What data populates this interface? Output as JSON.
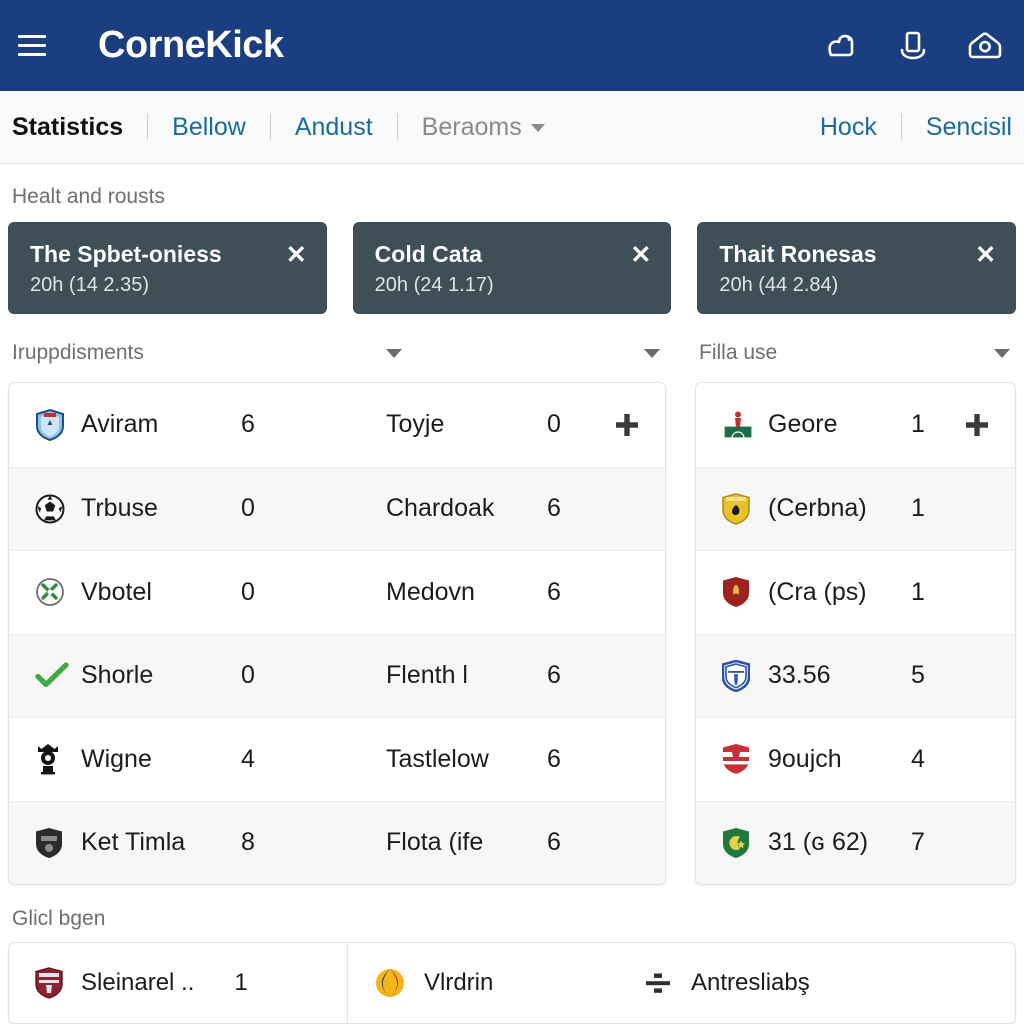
{
  "appbar": {
    "menu_icon": "hamburger-menu-icon",
    "brand": "CorneKick",
    "actions": [
      {
        "name": "thumb-outline-icon",
        "label": ""
      },
      {
        "name": "device-outline-icon",
        "label": ""
      },
      {
        "name": "camera-home-outline-icon",
        "label": ""
      }
    ]
  },
  "subnav": {
    "left": [
      {
        "label": "Statistics",
        "state": "active"
      },
      {
        "label": "Bellow",
        "state": "link"
      },
      {
        "label": "Andust",
        "state": "link"
      },
      {
        "label": "Beraoms",
        "state": "muted",
        "caret": true
      }
    ],
    "right": [
      {
        "label": "Hock",
        "state": "link"
      },
      {
        "label": "Sencisil",
        "state": "link"
      }
    ]
  },
  "sections": {
    "cards_label": "Healt and rousts",
    "bottom_label": "Glicl bgen"
  },
  "cards": [
    {
      "title": "The Spbet-oniess",
      "subtitle": "20h (14 2.35)",
      "close": "✕"
    },
    {
      "title": "Cold Cata",
      "subtitle": "20h (24 1.17)",
      "close": "✕"
    },
    {
      "title": "Thait Ronesas",
      "subtitle": "20h (44 2.84)",
      "close": "✕"
    }
  ],
  "left_panel": {
    "filter_label": "Iruppdisments",
    "caret_left": "chevron-down-icon",
    "caret_right": "chevron-down-icon",
    "rows": [
      {
        "icon": "crest-blue-shield-icon",
        "name": "Aviram",
        "value": "6",
        "name2": "Toyje",
        "value2": "0",
        "add": "+"
      },
      {
        "icon": "soccer-ball-icon",
        "name": "Trbuse",
        "value": "0",
        "name2": "Chardoak",
        "value2": "6",
        "add": ""
      },
      {
        "icon": "tools-circle-icon",
        "name": "Vbotel",
        "value": "0",
        "name2": "Medovn",
        "value2": "6",
        "add": ""
      },
      {
        "icon": "green-check-icon",
        "name": "Shorle",
        "value": "0",
        "name2": "Flenth l",
        "value2": "6",
        "add": ""
      },
      {
        "icon": "crest-black-crown-icon",
        "name": "Wigne",
        "value": "4",
        "name2": "Tastlelow",
        "value2": "6",
        "add": ""
      },
      {
        "icon": "crest-dark-shield-icon",
        "name": "Ket Timla",
        "value": "8",
        "name2": "Flota (ife",
        "value2": "6",
        "add": ""
      }
    ]
  },
  "right_panel": {
    "filter_label": "Filla use",
    "caret": "chevron-down-icon",
    "rows": [
      {
        "icon": "pitch-player-icon",
        "name": "Geore",
        "value": "1",
        "add": "+"
      },
      {
        "icon": "crest-yellow-icon",
        "name": "(Cerbna)",
        "value": "1",
        "add": ""
      },
      {
        "icon": "crest-red-icon",
        "name": "(Cra (ps)",
        "value": "1",
        "add": ""
      },
      {
        "icon": "crest-blue-player-icon",
        "name": "33.56",
        "value": "5",
        "add": ""
      },
      {
        "icon": "crest-crimson-icon",
        "name": "9oujch",
        "value": "4",
        "add": ""
      },
      {
        "icon": "crest-green-icon",
        "name": "31 (ɢ 62)",
        "value": "7",
        "add": ""
      }
    ]
  },
  "bottom_bar": [
    {
      "icon": "crest-maroon-icon",
      "text": "Sleinarel ..",
      "value": "1"
    },
    {
      "icon": "color-burst-icon",
      "text": "Vlrdrin",
      "value": ""
    },
    {
      "icon": "divide-icon",
      "text": "Antresliabş",
      "value": ""
    }
  ],
  "colors": {
    "appbar_blue": "#1a3e80",
    "card_slate": "#3e4f58",
    "link_blue": "#1a6b99",
    "muted_gray": "#8a8a8a",
    "row_alt": "#f7f7f7",
    "green_check": "#3faa3f"
  }
}
